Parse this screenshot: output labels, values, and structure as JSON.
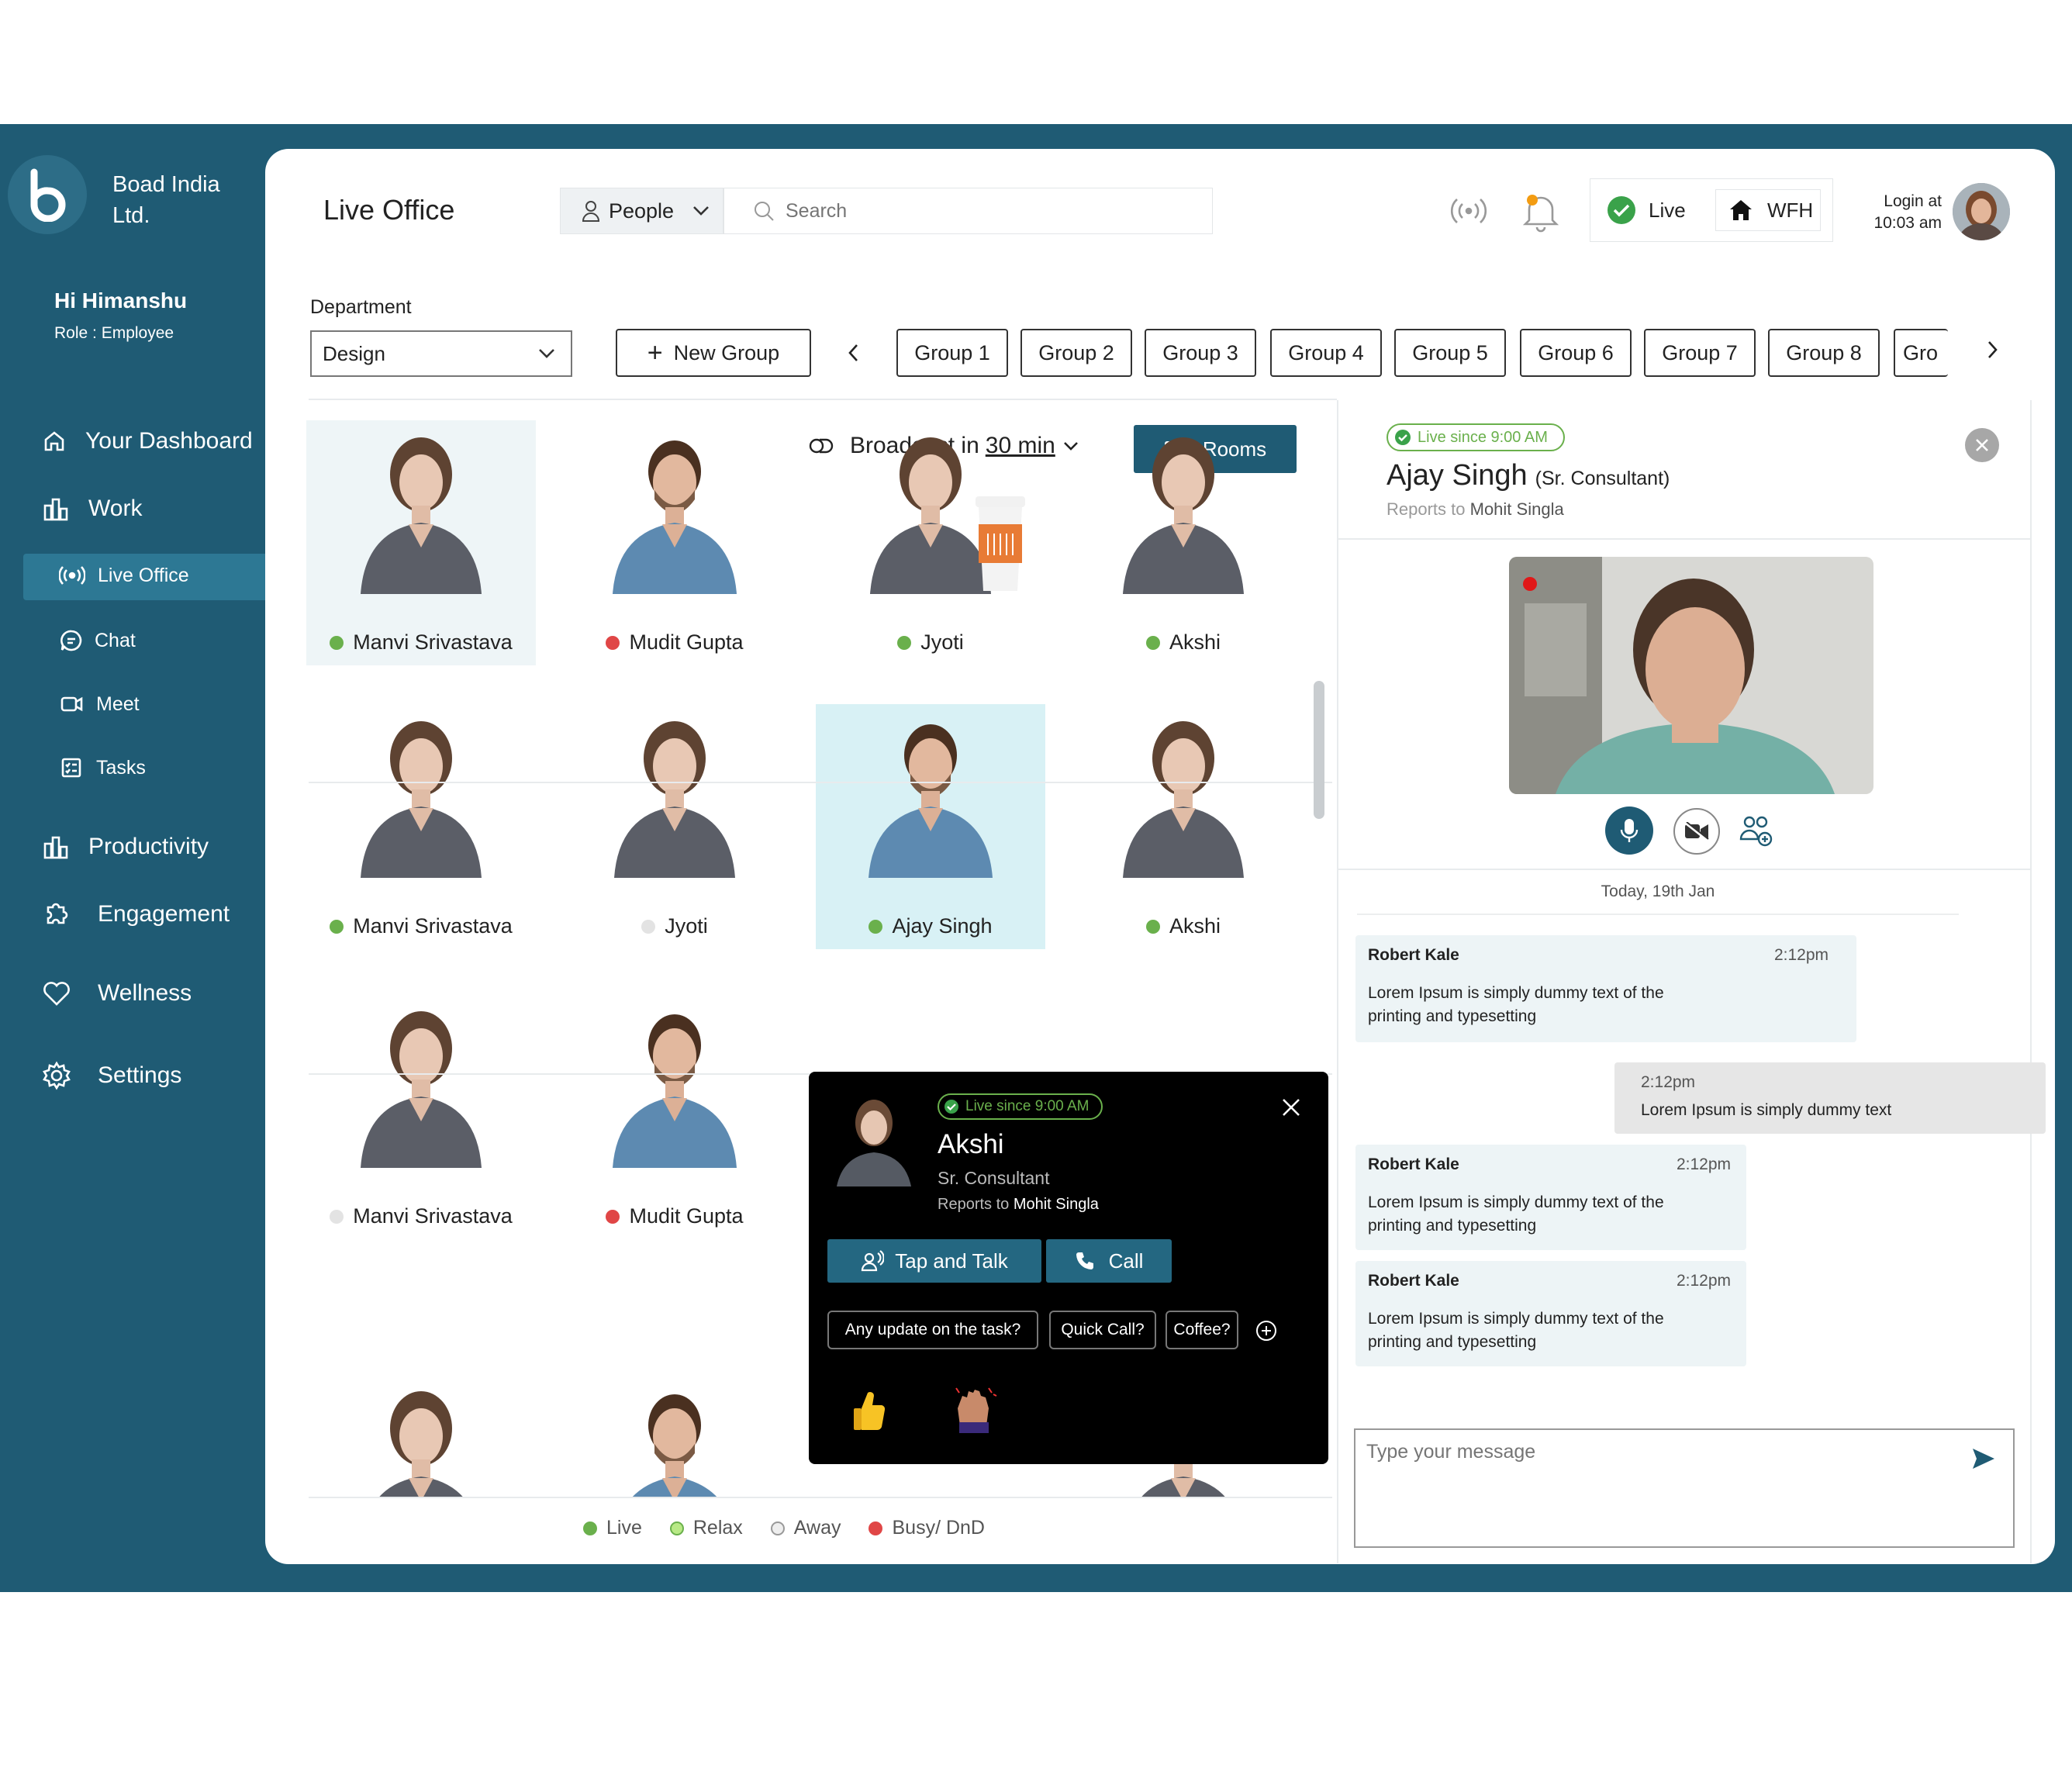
{
  "sidebar": {
    "company": [
      "Boad India",
      "Ltd."
    ],
    "greeting": "Hi Himanshu",
    "role": "Role : Employee",
    "items": {
      "dashboard": "Your Dashboard",
      "work": "Work",
      "live_office": "Live Office",
      "chat": "Chat",
      "meet": "Meet",
      "tasks": "Tasks",
      "productivity": "Productivity",
      "engagement": "Engagement",
      "wellness": "Wellness",
      "settings": "Settings"
    }
  },
  "header": {
    "title": "Live Office",
    "filter": "People",
    "search_placeholder": "Search",
    "status_live": "Live",
    "status_wfh": "WFH",
    "login_label": "Login at",
    "login_time": "10:03 am"
  },
  "department": {
    "label": "Department",
    "value": "Design",
    "new_group": "New Group",
    "groups": [
      "Group 1",
      "Group 2",
      "Group 3",
      "Group 4",
      "Group 5",
      "Group 6",
      "Group 7",
      "Group 8",
      "Gro"
    ]
  },
  "toolbar": {
    "broadcast_prefix": "Broadcast in",
    "broadcast_time": "30 min",
    "rooms": "Rooms"
  },
  "people": [
    {
      "name": "Manvi Srivastava",
      "status": "live",
      "gender": "f"
    },
    {
      "name": "Mudit Gupta",
      "status": "busy",
      "gender": "m"
    },
    {
      "name": "Jyoti",
      "status": "live",
      "gender": "f"
    },
    {
      "name": "Akshi",
      "status": "live",
      "gender": "f"
    },
    {
      "name": "Manvi Srivastava",
      "status": "live",
      "gender": "f"
    },
    {
      "name": "Jyoti",
      "status": "away",
      "gender": "f"
    },
    {
      "name": "Ajay Singh",
      "status": "live",
      "gender": "m"
    },
    {
      "name": "Akshi",
      "status": "live",
      "gender": "f"
    },
    {
      "name": "Manvi Srivastava",
      "status": "away",
      "gender": "f"
    },
    {
      "name": "Mudit Gupta",
      "status": "busy",
      "gender": "m"
    }
  ],
  "legend": [
    "Live",
    "Relax",
    "Away",
    "Busy/ DnD"
  ],
  "popup": {
    "live_since": "Live since 9:00 AM",
    "name": "Akshi",
    "title": "Sr. Consultant",
    "reports_prefix": "Reports to",
    "reports_to": "Mohit Singla",
    "tap_talk": "Tap and Talk",
    "call": "Call",
    "quick": [
      "Any update on the task?",
      "Quick Call?",
      "Coffee?"
    ]
  },
  "profile": {
    "live_since": "Live since 9:00 AM",
    "name": "Ajay Singh",
    "title": "(Sr. Consultant)",
    "reports_prefix": "Reports to",
    "reports_to": "Mohit Singla"
  },
  "chat": {
    "date": "Today, 19th Jan",
    "messages": [
      {
        "sender": "Robert Kale",
        "time": "2:12pm",
        "text": [
          "Lorem Ipsum is simply dummy text of the",
          "printing and typesetting"
        ]
      },
      {
        "sender": "",
        "time": "2:12pm",
        "text": [
          "Lorem Ipsum is simply dummy text"
        ]
      },
      {
        "sender": "Robert Kale",
        "time": "2:12pm",
        "text": [
          "Lorem Ipsum is simply dummy text of the",
          "printing and typesetting"
        ]
      },
      {
        "sender": "Robert Kale",
        "time": "2:12pm",
        "text": [
          "Lorem Ipsum is simply dummy text of the",
          "printing and typesetting"
        ]
      }
    ],
    "input_placeholder": "Type your message"
  },
  "colors": {
    "brand": "#1f5b74",
    "live": "#6ab04c",
    "busy": "#e04646",
    "relax": "#b8e986",
    "away": "#e3e3e3"
  }
}
